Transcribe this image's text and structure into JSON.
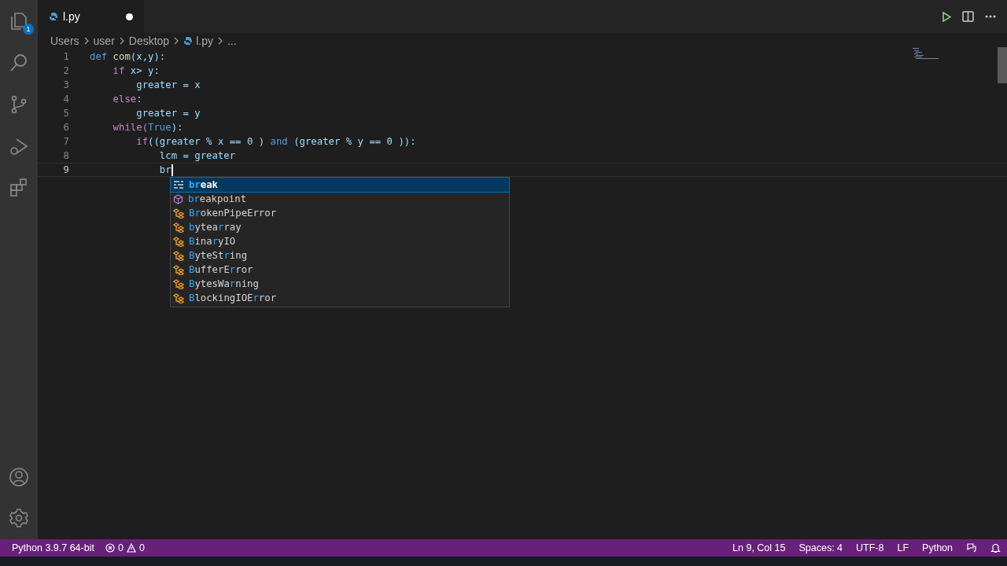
{
  "activity_bar": {
    "items": [
      {
        "kind": "explorer",
        "badge": "1"
      },
      {
        "kind": "search"
      },
      {
        "kind": "source-control"
      },
      {
        "kind": "run"
      },
      {
        "kind": "extensions"
      }
    ],
    "bottom_items": [
      {
        "kind": "account"
      },
      {
        "kind": "settings"
      }
    ]
  },
  "tabs": [
    {
      "label": "l.py",
      "selected": true,
      "modified": true
    }
  ],
  "breadcrumb": [
    "Users",
    "user",
    "Desktop",
    "l.py",
    "..."
  ],
  "editor": {
    "lines": [
      {
        "number": "1",
        "current": false,
        "tokens": [
          {
            "text": "def",
            "kind": "keyword"
          },
          {
            "text": " com",
            "kind": "function"
          },
          {
            "text": "(x,y):",
            "kind": "variable"
          }
        ]
      },
      {
        "number": "2",
        "current": false,
        "tokens": [
          {
            "text": "    if",
            "kind": "control"
          },
          {
            "text": " x> y:",
            "kind": "variable"
          }
        ]
      },
      {
        "number": "3",
        "current": false,
        "tokens": [
          {
            "text": "        greater = x",
            "kind": "variable"
          }
        ]
      },
      {
        "number": "4",
        "current": false,
        "tokens": [
          {
            "text": "    else",
            "kind": "control"
          },
          {
            "text": ":",
            "kind": "variable"
          }
        ]
      },
      {
        "number": "5",
        "current": false,
        "tokens": [
          {
            "text": "        greater = y",
            "kind": "variable"
          }
        ]
      },
      {
        "number": "6",
        "current": false,
        "tokens": [
          {
            "text": "    while(",
            "kind": "control"
          },
          {
            "text": "True",
            "kind": "keyword"
          },
          {
            "text": "):",
            "kind": "variable"
          }
        ]
      },
      {
        "number": "7",
        "current": false,
        "tokens": [
          {
            "text": "        if",
            "kind": "control"
          },
          {
            "text": "((greater % x == 0 ) ",
            "kind": "variable"
          },
          {
            "text": "and",
            "kind": "keyword"
          },
          {
            "text": " (greater % y == 0 )):",
            "kind": "variable"
          }
        ]
      },
      {
        "number": "8",
        "current": false,
        "tokens": [
          {
            "text": "            lcm = greater",
            "kind": "variable"
          }
        ]
      },
      {
        "number": "9",
        "current": true,
        "tokens": [
          {
            "text": "            br",
            "kind": "variable"
          }
        ]
      }
    ]
  },
  "suggestions": [
    {
      "kind": "keyword",
      "selected": true,
      "parts": [
        {
          "text": "br",
          "matched": true
        },
        {
          "text": "eak",
          "matched": false
        }
      ]
    },
    {
      "kind": "module",
      "selected": false,
      "parts": [
        {
          "text": "br",
          "matched": true
        },
        {
          "text": "eakpoint",
          "matched": false
        }
      ]
    },
    {
      "kind": "class",
      "selected": false,
      "parts": [
        {
          "text": "Br",
          "matched": true
        },
        {
          "text": "okenPipeError",
          "matched": false
        }
      ]
    },
    {
      "kind": "class",
      "selected": false,
      "parts": [
        {
          "text": "b",
          "matched": true
        },
        {
          "text": "ytea",
          "matched": false
        },
        {
          "text": "r",
          "matched": true
        },
        {
          "text": "ray",
          "matched": false
        }
      ]
    },
    {
      "kind": "class",
      "selected": false,
      "parts": [
        {
          "text": "B",
          "matched": true
        },
        {
          "text": "ina",
          "matched": false
        },
        {
          "text": "r",
          "matched": true
        },
        {
          "text": "yIO",
          "matched": false
        }
      ]
    },
    {
      "kind": "class",
      "selected": false,
      "parts": [
        {
          "text": "B",
          "matched": true
        },
        {
          "text": "yteSt",
          "matched": false
        },
        {
          "text": "r",
          "matched": true
        },
        {
          "text": "ing",
          "matched": false
        }
      ]
    },
    {
      "kind": "class",
      "selected": false,
      "parts": [
        {
          "text": "B",
          "matched": true
        },
        {
          "text": "ufferE",
          "matched": false
        },
        {
          "text": "r",
          "matched": true
        },
        {
          "text": "ror",
          "matched": false
        }
      ]
    },
    {
      "kind": "class",
      "selected": false,
      "parts": [
        {
          "text": "B",
          "matched": true
        },
        {
          "text": "ytesWa",
          "matched": false
        },
        {
          "text": "r",
          "matched": true
        },
        {
          "text": "ning",
          "matched": false
        }
      ]
    },
    {
      "kind": "class",
      "selected": false,
      "parts": [
        {
          "text": "B",
          "matched": true
        },
        {
          "text": "lockingIOE",
          "matched": false
        },
        {
          "text": "r",
          "matched": true
        },
        {
          "text": "ror",
          "matched": false
        }
      ]
    }
  ],
  "status_bar": {
    "interpreter": "Python 3.9.7 64-bit",
    "errors": "0",
    "warnings": "0",
    "right": [
      "Ln 9, Col 15",
      "Spaces: 4",
      "UTF-8",
      "LF",
      "Python"
    ]
  }
}
